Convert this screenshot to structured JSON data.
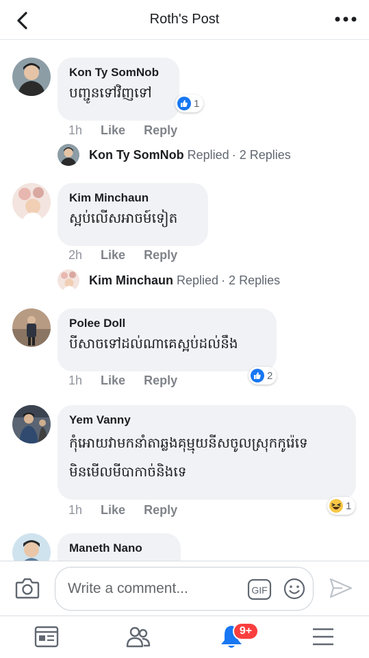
{
  "header": {
    "title": "Roth's Post"
  },
  "comments": [
    {
      "author": "Kon Ty SomNob",
      "text": "បញ្ជូនទៅវិញទៅ",
      "time": "1h",
      "like": "Like",
      "reply": "Reply",
      "reaction": {
        "icon": "like-icon",
        "count": "1"
      },
      "replies": {
        "name": "Kon Ty SomNob",
        "text": "Replied",
        "count": "· 2 Replies"
      }
    },
    {
      "author": "Kim Minchaun",
      "text": "ស្អប់លើសអាចម៍ទៀត",
      "time": "2h",
      "like": "Like",
      "reply": "Reply",
      "replies": {
        "name": "Kim Minchaun",
        "text": "Replied",
        "count": "· 2 Replies"
      }
    },
    {
      "author": "Polee Doll",
      "text": "បីសាចទៅដល់ណាគេស្អប់ដល់នឹង",
      "time": "1h",
      "like": "Like",
      "reply": "Reply",
      "reaction": {
        "icon": "like-icon",
        "count": "2"
      }
    },
    {
      "author": "Yem Vanny",
      "text_line1": "កុំអោយវាមកនាំតាឆ្លងគុម្មុយនីសចូលស្រុកកូរ៉េទេ",
      "text_line2": "មិនមើលមីបាកាច់និងទេ",
      "time": "1h",
      "like": "Like",
      "reply": "Reply",
      "reaction": {
        "icon": "haha-icon",
        "count": "1"
      }
    },
    {
      "author": "Maneth Nano"
    }
  ],
  "composer": {
    "placeholder": "Write a comment...",
    "gif_label": "GIF"
  },
  "tabbar": {
    "notifications_badge": "9+"
  },
  "colors": {
    "accent": "#1877f2",
    "badge": "#fa3e3e",
    "bubble": "#f0f2f5"
  }
}
